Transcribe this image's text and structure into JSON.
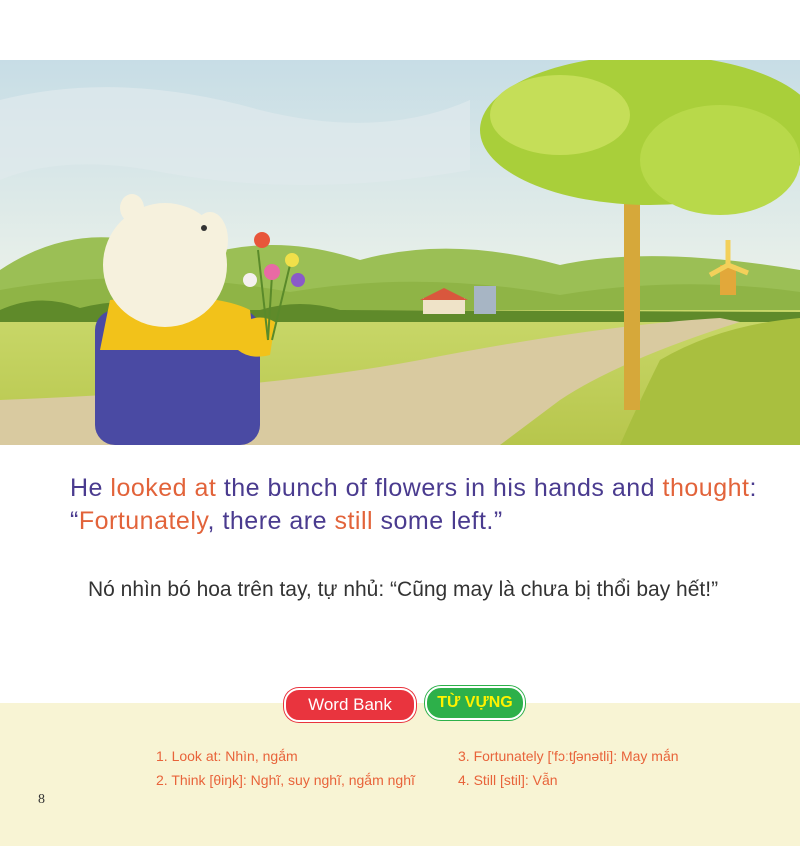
{
  "story": {
    "en": {
      "p1": "He ",
      "p2": "looked at",
      "p3": " the bunch of flowers in his hands and ",
      "p4": "thought",
      "p5": ": “",
      "p6": "Fortunately",
      "p7": ", there are ",
      "p8": "still",
      "p9": " some left.”"
    },
    "vi": "Nó nhìn bó hoa trên tay, tự nhủ: “Cũng may là chưa bị thổi bay hết!”"
  },
  "word_bank": {
    "title": "Word Bank",
    "subtitle": "TỪ VỰNG",
    "items": [
      "1. Look at: Nhìn, ngắm",
      "2. Think [θiŋk]: Nghĩ, suy nghĩ, ngắm nghĩ",
      "3. Fortunately ['fɔːtʃənətli]: May mắn",
      "4. Still [stil]: Vẫn"
    ]
  },
  "page_number": "8",
  "colors": {
    "english_text": "#4a3b8f",
    "highlight": "#e2633a",
    "word_bank_bg": "#f8f4d4",
    "badge_red": "#e9343e",
    "badge_green": "#2db04a"
  },
  "illustration": {
    "subject": "bear-holding-flowers",
    "elements": [
      "sky",
      "hills",
      "windmill",
      "farmhouse",
      "tree",
      "dirt-road",
      "field"
    ]
  }
}
